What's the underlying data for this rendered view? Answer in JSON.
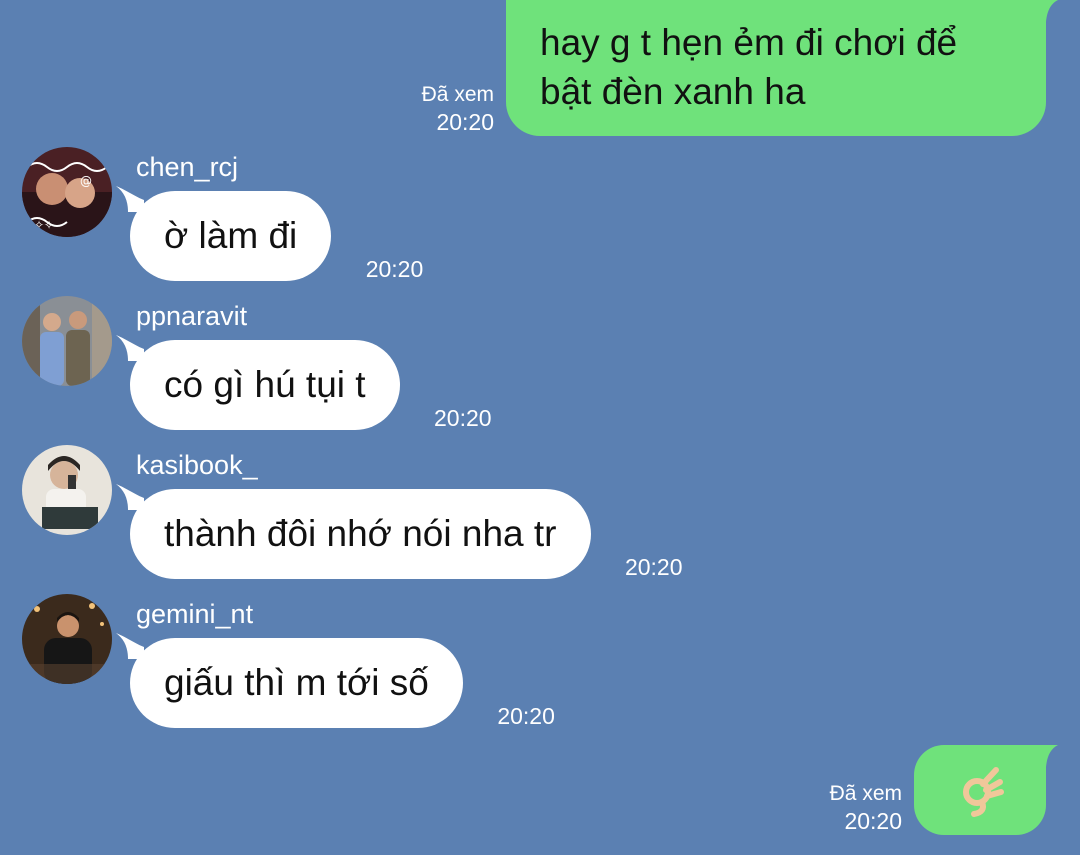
{
  "colors": {
    "background": "#5b80b2",
    "outgoing_bubble": "#6fe27b",
    "incoming_bubble": "#ffffff"
  },
  "messages": [
    {
      "direction": "outgoing",
      "text": "hay g t hẹn ẻm đi chơi để bật đèn xanh ha",
      "status": "Đã xem",
      "time": "20:20"
    },
    {
      "direction": "incoming",
      "username": "chen_rcj",
      "avatar": "avatar-chen",
      "text": "ờ làm đi",
      "time": "20:20"
    },
    {
      "direction": "incoming",
      "username": "ppnaravit",
      "avatar": "avatar-ppnaravit",
      "text": "có gì hú tụi t",
      "time": "20:20"
    },
    {
      "direction": "incoming",
      "username": "kasibook_",
      "avatar": "avatar-kasibook",
      "text": "thành đôi nhớ nói nha tr",
      "time": "20:20"
    },
    {
      "direction": "incoming",
      "username": "gemini_nt",
      "avatar": "avatar-gemini",
      "text": "giấu thì m tới số",
      "time": "20:20"
    },
    {
      "direction": "outgoing",
      "emoji": "👌",
      "emoji_icon": "ok-hand-icon",
      "status": "Đã xem",
      "time": "20:20"
    }
  ]
}
